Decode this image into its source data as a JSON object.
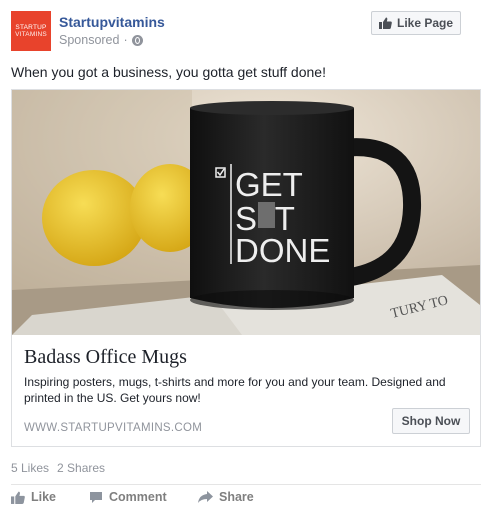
{
  "post": {
    "avatar": {
      "line1": "STARTUP",
      "line2": "VITAMINS"
    },
    "page_name": "Startupvitamins",
    "sponsored": "Sponsored",
    "dot": "·",
    "like_page_label": "Like Page",
    "caption": "When you got a business, you gotta get stuff done!"
  },
  "ad": {
    "mug_lines": [
      "GET",
      "S  T",
      "DONE"
    ],
    "newspaper_text": "TURY TO",
    "title": "Badass Office Mugs",
    "description": "Inspiring posters, mugs, t-shirts and more for you and your team. Designed and printed in the US. Get yours now!",
    "url": "WWW.STARTUPVITAMINS.COM",
    "cta_label": "Shop Now"
  },
  "engagement": {
    "likes": "5 Likes",
    "shares": "2 Shares"
  },
  "actions": {
    "like": "Like",
    "comment": "Comment",
    "share": "Share"
  },
  "colors": {
    "brand": "#e8432c",
    "link": "#365899",
    "muted": "#90949c",
    "mug": "#1c1c1c",
    "lemon": "#e9c21c"
  },
  "icons": [
    "globe-icon",
    "thumbs-up-icon",
    "comment-icon",
    "share-icon",
    "checkbox-icon"
  ]
}
